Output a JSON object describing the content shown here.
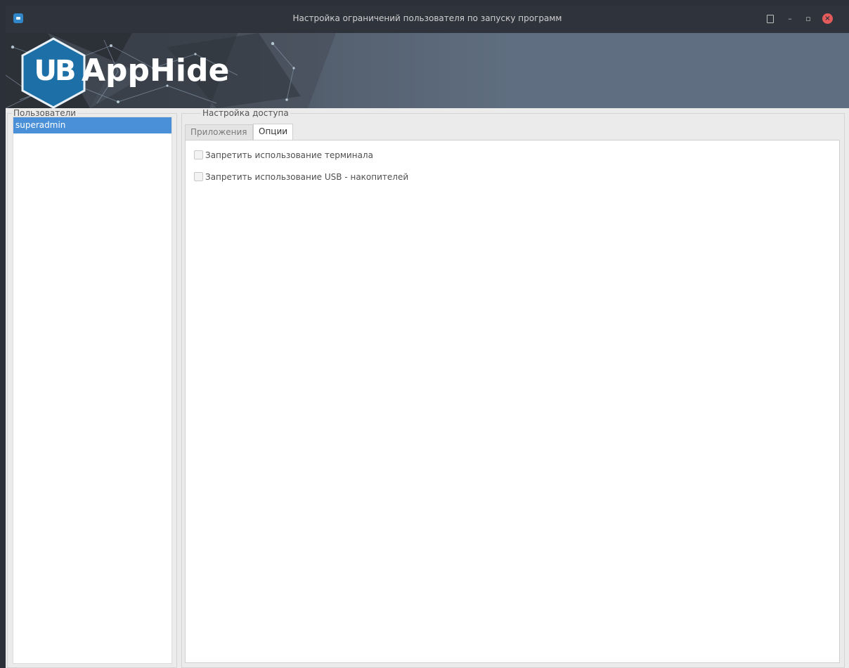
{
  "window": {
    "title": "Настройка ограничений пользователя по запуску программ"
  },
  "banner": {
    "logo_badge": "UB",
    "logo_text": "AppHide"
  },
  "users": {
    "group_label": "Пользователи",
    "items": [
      {
        "name": "superadmin",
        "selected": true
      }
    ]
  },
  "access": {
    "group_label": "Настройка доступа",
    "tabs": [
      {
        "label": "Приложения",
        "active": false
      },
      {
        "label": "Опции",
        "active": true
      }
    ],
    "options": [
      {
        "label": "Запретить использование терминала",
        "checked": false
      },
      {
        "label": "Запретить использование USB - накопителей",
        "checked": false
      }
    ]
  },
  "colors": {
    "titlebar": "#2f333c",
    "selection": "#4a90d9",
    "close_button": "#e35b5b",
    "logo_hex": "#1d6fa8"
  },
  "icons": [
    "app-icon",
    "menu-icon",
    "minimize-icon",
    "maximize-icon",
    "close-icon"
  ]
}
